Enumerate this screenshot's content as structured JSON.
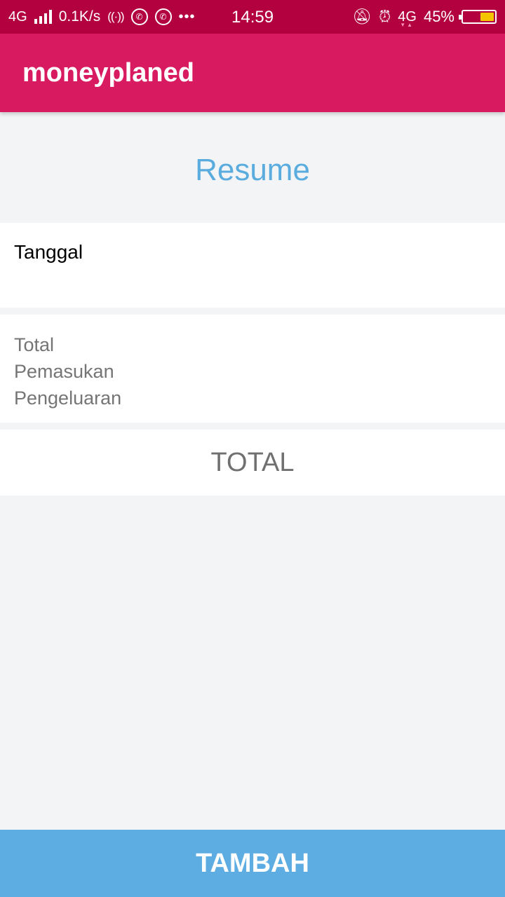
{
  "status_bar": {
    "network_left": "4G",
    "speed": "0.1K/s",
    "time": "14:59",
    "network_right": "4G",
    "battery_percent": "45%",
    "battery_level": 0.45,
    "battery_color": "#f5c400"
  },
  "app_bar": {
    "title": "moneyplaned",
    "color": "#d81b60"
  },
  "main": {
    "heading": "Resume",
    "heading_color": "#5aacdf",
    "date_label": "Tanggal",
    "summary_items": [
      "Total",
      "Pemasukan",
      "Pengeluaran"
    ],
    "total_label": "TOTAL"
  },
  "actions": {
    "add_label": "TAMBAH",
    "add_color": "#5dade2"
  }
}
